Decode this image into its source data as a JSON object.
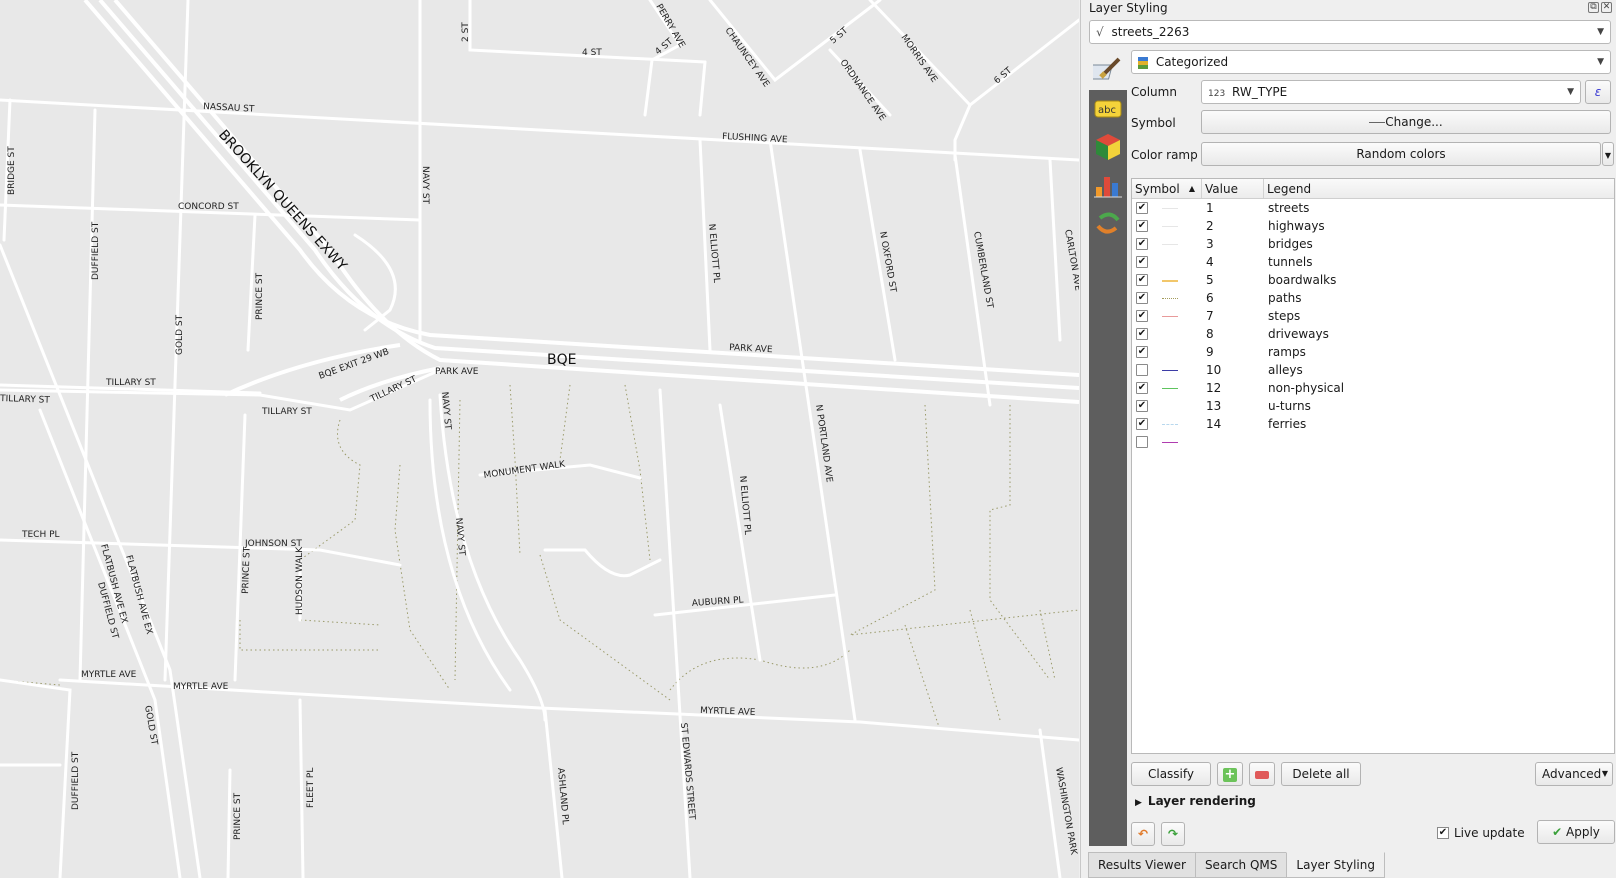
{
  "map": {
    "labels": {
      "nassau": "NASSAU ST",
      "bqe_long": "BROOKLYN QUEENS EXWY",
      "flushing": "FLUSHING AVE",
      "concord": "CONCORD ST",
      "bridge": "BRIDGE ST",
      "duffield1": "DUFFIELD ST",
      "gold1": "GOLD ST",
      "prince1": "PRINCE ST",
      "navy1": "NAVY ST",
      "n_elliott1": "N ELLIOTT PL",
      "n_oxford": "N OXFORD ST",
      "cumberland": "CUMBERLAND ST",
      "carlton": "CARLTON AVE",
      "park_ave1": "PARK AVE",
      "bqe": "BQE",
      "bqe_exit": "BQE EXIT 29 WB",
      "park_ave2": "PARK AVE",
      "tillary1": "TILLARY ST",
      "tillary2": "TILLARY ST",
      "tillary3": "TILLARY ST",
      "tillary4": "TILLARY ST",
      "navy2": "NAVY ST",
      "monument": "MONUMENT WALK",
      "n_portland": "N PORTLAND AVE",
      "n_elliott2": "N ELLIOTT PL",
      "tech": "TECH PL",
      "johnson": "JOHNSON ST",
      "navy3": "NAVY ST",
      "hudson": "HUDSON WALK",
      "prince2": "PRINCE ST",
      "flatbush_ex": "FLATBUSH AVE EX",
      "flatbush_ex2": "FLATBUSH AVE EX",
      "duffield2": "DUFFIELD ST",
      "auburn": "AUBURN PL",
      "myrtle1": "MYRTLE AVE",
      "myrtle2": "MYRTLE AVE",
      "myrtle3": "MYRTLE AVE",
      "gold2": "GOLD ST",
      "duffield3": "DUFFIELD ST",
      "prince3": "PRINCE ST",
      "fleet": "FLEET PL",
      "ashland": "ASHLAND PL",
      "st_edwards": "ST EDWARDS STREET",
      "washington": "WASHINGTON PARK",
      "st2": "2 ST",
      "st4a": "4 ST",
      "st4b": "4 ST",
      "perry": "PERRY AVE",
      "chauncey": "CHAUNCEY AVE",
      "st5": "5 ST",
      "ordnance": "ORDNANCE AVE",
      "morris": "MORRIS AVE",
      "st6": "6 ST"
    }
  },
  "panel": {
    "title": "Layer Styling",
    "layer_name": "streets_2263",
    "renderer": "Categorized",
    "column_label": "Column",
    "column_value": "RW_TYPE",
    "column_type": "123",
    "symbol_label": "Symbol",
    "symbol_button": "Change...",
    "color_ramp_label": "Color ramp",
    "color_ramp_value": "Random colors",
    "headers": {
      "symbol": "Symbol",
      "value": "Value",
      "legend": "Legend"
    },
    "rows": [
      {
        "checked": true,
        "value": "1",
        "legend": "streets",
        "color": "#e6e6e6",
        "style": "solid"
      },
      {
        "checked": true,
        "value": "2",
        "legend": "highways",
        "color": "#e6e6e6",
        "style": "solid"
      },
      {
        "checked": true,
        "value": "3",
        "legend": "bridges",
        "color": "#e6e6e6",
        "style": "solid"
      },
      {
        "checked": true,
        "value": "4",
        "legend": "tunnels",
        "color": "#ffffff",
        "style": "solid"
      },
      {
        "checked": true,
        "value": "5",
        "legend": "boardwalks",
        "color": "#f2c76b",
        "style": "solid"
      },
      {
        "checked": true,
        "value": "6",
        "legend": "paths",
        "color": "#a49c5c",
        "style": "dotted"
      },
      {
        "checked": true,
        "value": "7",
        "legend": "steps",
        "color": "#e89a9a",
        "style": "solid"
      },
      {
        "checked": true,
        "value": "8",
        "legend": "driveways",
        "color": "#ffffff",
        "style": "solid"
      },
      {
        "checked": true,
        "value": "9",
        "legend": "ramps",
        "color": "#ffffff",
        "style": "solid"
      },
      {
        "checked": false,
        "value": "10",
        "legend": "alleys",
        "color": "#3c3ca6",
        "style": "solid"
      },
      {
        "checked": true,
        "value": "12",
        "legend": "non-physical",
        "color": "#5fc45f",
        "style": "solid"
      },
      {
        "checked": true,
        "value": "13",
        "legend": "u-turns",
        "color": "#ffffff",
        "style": "solid"
      },
      {
        "checked": true,
        "value": "14",
        "legend": "ferries",
        "color": "#b8d8ee",
        "style": "dashed"
      },
      {
        "checked": false,
        "value": "",
        "legend": "",
        "color": "#b03cb0",
        "style": "solid"
      }
    ],
    "classify": "Classify",
    "delete_all": "Delete all",
    "advanced": "Advanced",
    "layer_rendering": "Layer rendering",
    "live_update": "Live update",
    "live_update_checked": true,
    "apply": "Apply",
    "tabs": [
      "Results Viewer",
      "Search QMS",
      "Layer Styling"
    ]
  }
}
